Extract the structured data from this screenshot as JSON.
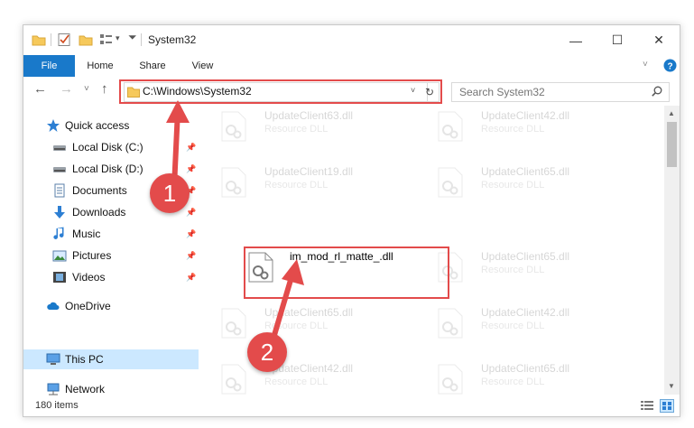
{
  "window": {
    "title": "System32",
    "minimize_glyph": "—",
    "maximize_glyph": "☐",
    "close_glyph": "✕"
  },
  "ribbon": {
    "tabs": [
      "File",
      "Home",
      "Share",
      "View"
    ]
  },
  "navigation": {
    "back_glyph": "←",
    "forward_glyph": "→",
    "recent_glyph": "˅",
    "up_glyph": "↑"
  },
  "address": {
    "path": "C:\\Windows\\System32",
    "dropdown_glyph": "˅",
    "refresh_glyph": "↻"
  },
  "search": {
    "placeholder": "Search System32"
  },
  "sidebar": {
    "items": [
      {
        "label": "Quick access",
        "icon": "star-icon"
      },
      {
        "label": "Local Disk (C:)",
        "icon": "drive-icon",
        "pinned": true
      },
      {
        "label": "Local Disk (D:)",
        "icon": "drive-icon",
        "pinned": true
      },
      {
        "label": "Documents",
        "icon": "documents-icon",
        "pinned": true
      },
      {
        "label": "Downloads",
        "icon": "download-icon",
        "pinned": true
      },
      {
        "label": "Music",
        "icon": "music-icon",
        "pinned": true
      },
      {
        "label": "Pictures",
        "icon": "pictures-icon",
        "pinned": true
      },
      {
        "label": "Videos",
        "icon": "videos-icon",
        "pinned": true
      },
      {
        "label": "OneDrive",
        "icon": "cloud-icon"
      },
      {
        "label": "This PC",
        "icon": "computer-icon",
        "selected": true
      },
      {
        "label": "Network",
        "icon": "network-icon"
      }
    ],
    "pin_glyph": "📌"
  },
  "files": [
    {
      "name": "UpdateClient63.dll",
      "type": "Resource DLL",
      "faded": true
    },
    {
      "name": "UpdateClient42.dll",
      "type": "Resource DLL",
      "faded": true
    },
    {
      "name": "UpdateClient19.dll",
      "type": "Resource DLL",
      "faded": true
    },
    {
      "name": "UpdateClient65.dll",
      "type": "Resource DLL",
      "faded": true
    },
    {
      "name": "im_mod_rl_matte_.dll",
      "type": "",
      "faded": false
    },
    {
      "name": "UpdateClient65.dll",
      "type": "Resource DLL",
      "faded": true
    },
    {
      "name": "UpdateClient65.dll",
      "type": "Resource DLL",
      "faded": true
    },
    {
      "name": "UpdateClient42.dll",
      "type": "Resource DLL",
      "faded": true
    },
    {
      "name": "UpdateClient42.dll",
      "type": "Resource DLL",
      "faded": true
    },
    {
      "name": "UpdateClient65.dll",
      "type": "Resource DLL",
      "faded": true
    }
  ],
  "status": {
    "item_count": "180 items"
  },
  "annotations": {
    "step1": "1",
    "step2": "2",
    "accent_color": "#e34b4b"
  }
}
